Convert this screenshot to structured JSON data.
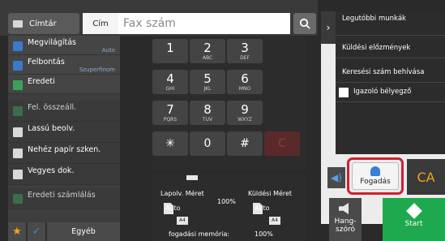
{
  "topbar": {
    "addressbook_label": "Címtár",
    "field_label": "Cím",
    "fax_placeholder": "Fax szám"
  },
  "settings": [
    {
      "label": "Megvilágítás",
      "value": "Auto",
      "icon_color": "#3c79c9"
    },
    {
      "label": "Felbontás",
      "value": "Szuperfinom",
      "icon_color": "#3c79c9"
    },
    {
      "label": "Eredeti",
      "value": "",
      "icon_color": "#3ba05a"
    },
    {
      "label": "Fel. összeáll.",
      "value": "",
      "icon_color": "#3ba05a"
    },
    {
      "label": "Lassú beolv.",
      "value": "",
      "icon_color": "#d9d9d9"
    },
    {
      "label": "Nehéz papír szken.",
      "value": "",
      "icon_color": "#d9d9d9"
    },
    {
      "label": "Vegyes dok.",
      "value": "",
      "icon_color": "#d9d9d9"
    },
    {
      "label": "Eredeti számlálás",
      "value": "",
      "icon_color": "#3ba05a"
    }
  ],
  "bottombar": {
    "other_label": "Egyéb"
  },
  "keypad": {
    "keys": [
      {
        "num": "1",
        "sub": ""
      },
      {
        "num": "2",
        "sub": "ABC"
      },
      {
        "num": "3",
        "sub": "DEF"
      },
      {
        "num": "4",
        "sub": "GHI"
      },
      {
        "num": "5",
        "sub": "JKL"
      },
      {
        "num": "6",
        "sub": "MNO"
      },
      {
        "num": "7",
        "sub": "PQRS"
      },
      {
        "num": "8",
        "sub": "TUV"
      },
      {
        "num": "9",
        "sub": "WXYZ"
      },
      {
        "num": "✳",
        "sub": ""
      },
      {
        "num": "0",
        "sub": ""
      },
      {
        "num": "#",
        "sub": ""
      }
    ],
    "clear_label": "C"
  },
  "status": {
    "recv_size_label": "Lapolv. Méret",
    "send_size_label": "Küldési Méret",
    "zoom": "100%",
    "recv_auto": "Auto",
    "send_auto": "Auto",
    "recv_paper": "A4",
    "send_paper": "A4",
    "memory_label": "fogadási memória:",
    "memory_value": "100%"
  },
  "right_panel": {
    "items": [
      "Legutóbbi munkák",
      "Küldési előzmények",
      "Keresési szám behívása"
    ],
    "stamp_label": "Igazoló bélyegző"
  },
  "actions": {
    "fogadas_label": "Fogadás",
    "ca_label": "CA",
    "volume_label": "Hang-szóró",
    "start_label": "Start"
  },
  "colors": {
    "highlight_frame": "#d21f2c",
    "start_green": "#1ea94e",
    "ca_orange": "#f4a21b"
  }
}
